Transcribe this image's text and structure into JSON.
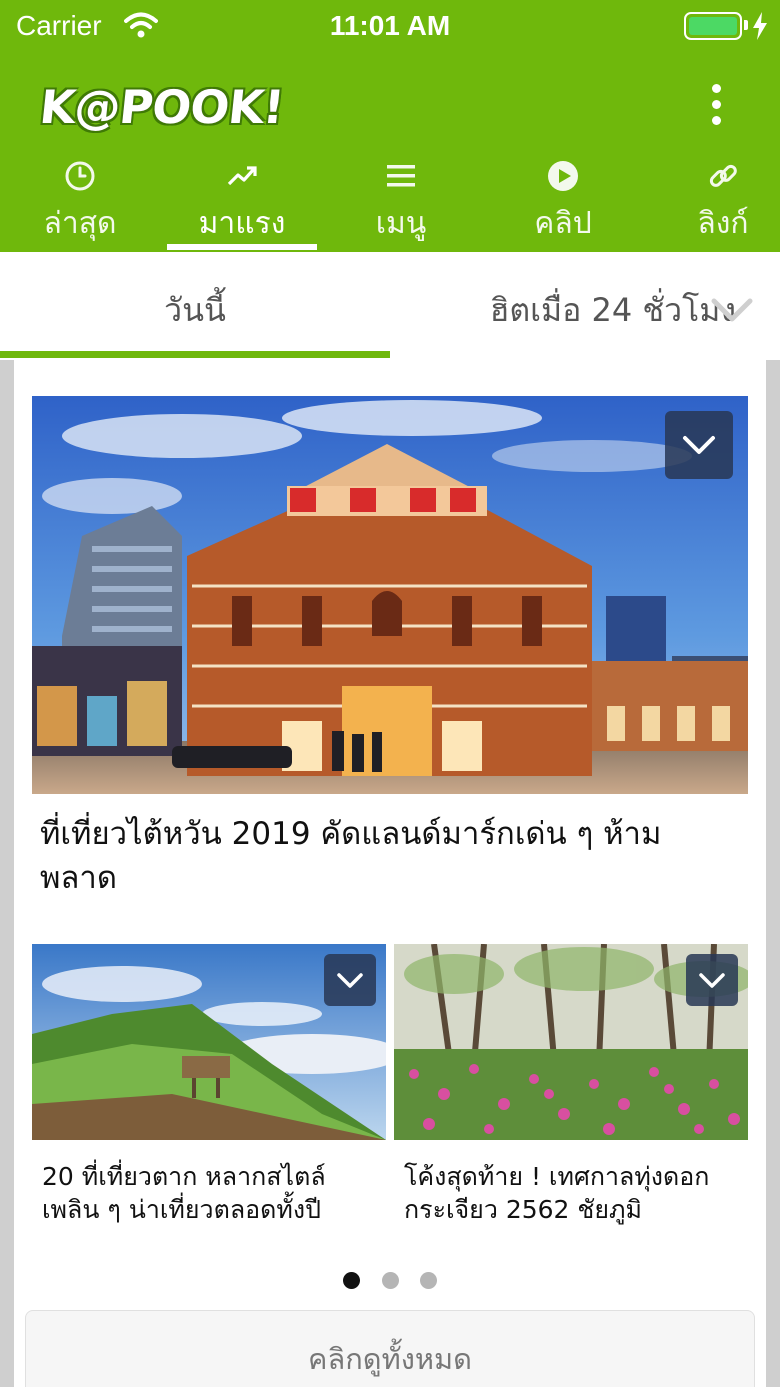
{
  "status_bar": {
    "carrier": "Carrier",
    "time": "11:01 AM"
  },
  "header": {
    "logo_text": "K@POOK!",
    "tabs": [
      {
        "label": "ล่าสุด",
        "icon": "clock-icon"
      },
      {
        "label": "มาแรง",
        "icon": "trending-icon"
      },
      {
        "label": "เมนู",
        "icon": "hamburger-icon"
      },
      {
        "label": "คลิป",
        "icon": "play-icon"
      },
      {
        "label": "ลิงก์",
        "icon": "link-icon"
      }
    ],
    "active_tab": "มาแรง"
  },
  "subtabs": {
    "today": "วันนี้",
    "hot": "ฮิตเมื่อ 24 ชั่วโมง"
  },
  "main": {
    "hero": {
      "title": "ที่เที่ยวไต้หวัน 2019 คัดแลนด์มาร์กเด่น ๆ ห้ามพลาด"
    },
    "cards": [
      {
        "title": "20 ที่เที่ยวตาก หลากสไตล์ เพลิน ๆ น่าเที่ยวตลอดทั้งปี"
      },
      {
        "title": "โค้งสุดท้าย ! เทศกาลทุ่งดอกกระเจียว 2562 ชัยภูมิ"
      }
    ],
    "pager": {
      "current": 1,
      "total": 3
    },
    "see_all": "คลิกดูทั้งหมด"
  },
  "colors": {
    "brand_green": "#6fb80c",
    "overlay_button": "#283755"
  }
}
